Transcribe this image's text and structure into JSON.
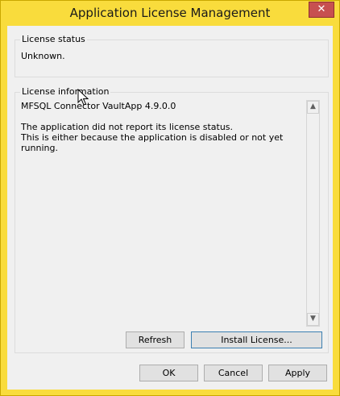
{
  "window": {
    "title": "Application License Management",
    "close_glyph": "✕",
    "frame_color": "#f9dc3c"
  },
  "license_status": {
    "label": "License status",
    "value": "Unknown."
  },
  "license_information": {
    "label": "License information",
    "text": "MFSQL Connector VaultApp 4.9.0.0\n\nThe application did not report its license status.\nThis is either because the application is disabled or not yet running.",
    "scroll_up_glyph": "▲",
    "scroll_down_glyph": "▼"
  },
  "buttons": {
    "refresh": "Refresh",
    "install_license": "Install License...",
    "ok": "OK",
    "cancel": "Cancel",
    "apply": "Apply"
  },
  "icons": {
    "close": "close-icon",
    "cursor": "mouse-cursor-icon"
  }
}
